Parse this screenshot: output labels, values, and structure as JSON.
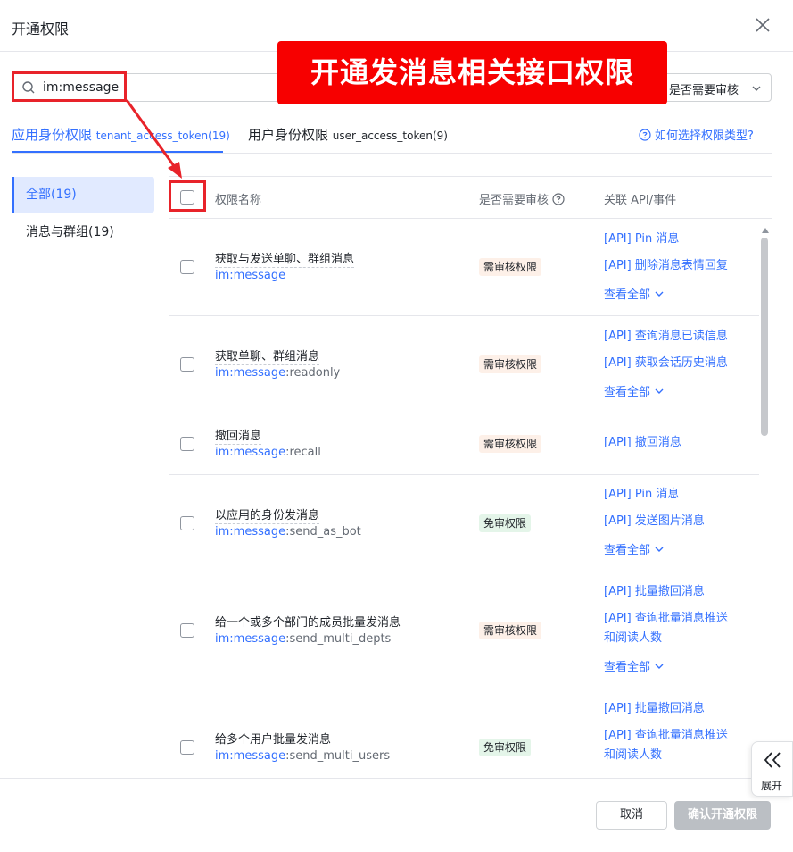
{
  "dialog": {
    "title": "开通权限",
    "close_label": "×"
  },
  "search": {
    "value": "im:message",
    "placeholder": ""
  },
  "review_filter": {
    "selected": "是否需要审核"
  },
  "tabs": [
    {
      "label": "应用身份权限",
      "token": "tenant_access_token(19)",
      "active": true
    },
    {
      "label": "用户身份权限",
      "token": "user_access_token(9)",
      "active": false
    }
  ],
  "help_link": "如何选择权限类型?",
  "sidebar": {
    "items": [
      {
        "label": "全部(19)",
        "active": true
      },
      {
        "label": "消息与群组(19)",
        "active": false
      }
    ]
  },
  "table": {
    "headers": {
      "name": "权限名称",
      "review": "是否需要审核",
      "api": "关联 API/事件"
    },
    "rows": [
      {
        "title": "获取与发送单聊、群组消息",
        "scope_ns": "im:message",
        "scope_rest": "",
        "badge": "需审核权限",
        "badge_type": "need",
        "apis": [
          "[API] Pin 消息",
          "[API] 删除消息表情回复"
        ],
        "view_all": "查看全部"
      },
      {
        "title": "获取单聊、群组消息",
        "scope_ns": "im:message",
        "scope_rest": ":readonly",
        "badge": "需审核权限",
        "badge_type": "need",
        "apis": [
          "[API] 查询消息已读信息",
          "[API] 获取会话历史消息"
        ],
        "view_all": "查看全部"
      },
      {
        "title": "撤回消息",
        "scope_ns": "im:message",
        "scope_rest": ":recall",
        "badge": "需审核权限",
        "badge_type": "need",
        "apis": [
          "[API] 撤回消息"
        ],
        "view_all": ""
      },
      {
        "title": "以应用的身份发消息",
        "scope_ns": "im:message",
        "scope_rest": ":send_as_bot",
        "badge": "免审权限",
        "badge_type": "free",
        "apis": [
          "[API] Pin 消息",
          "[API] 发送图片消息"
        ],
        "view_all": "查看全部"
      },
      {
        "title": "给一个或多个部门的成员批量发消息",
        "scope_ns": "im:message",
        "scope_rest": ":send_multi_depts",
        "badge": "需审核权限",
        "badge_type": "need",
        "apis": [
          "[API] 批量撤回消息",
          "[API] 查询批量消息推送",
          "和阅读人数"
        ],
        "view_all": "查看全部"
      },
      {
        "title": "给多个用户批量发消息",
        "scope_ns": "im:message",
        "scope_rest": ":send_multi_users",
        "badge": "免审权限",
        "badge_type": "free",
        "apis": [
          "[API] 批量撤回消息",
          "[API] 查询批量消息推送",
          "和阅读人数"
        ],
        "view_all": ""
      }
    ]
  },
  "footer": {
    "cancel": "取消",
    "confirm": "确认开通权限"
  },
  "expand_handle": {
    "label": "展开"
  },
  "annotation": {
    "banner": "开通发消息相关接口权限"
  },
  "colors": {
    "accent": "#3370ff",
    "annotation_red": "#e8232a",
    "banner_red": "#f70000",
    "badge_need_bg": "#fdf0e8",
    "badge_free_bg": "#e4f5e9"
  }
}
